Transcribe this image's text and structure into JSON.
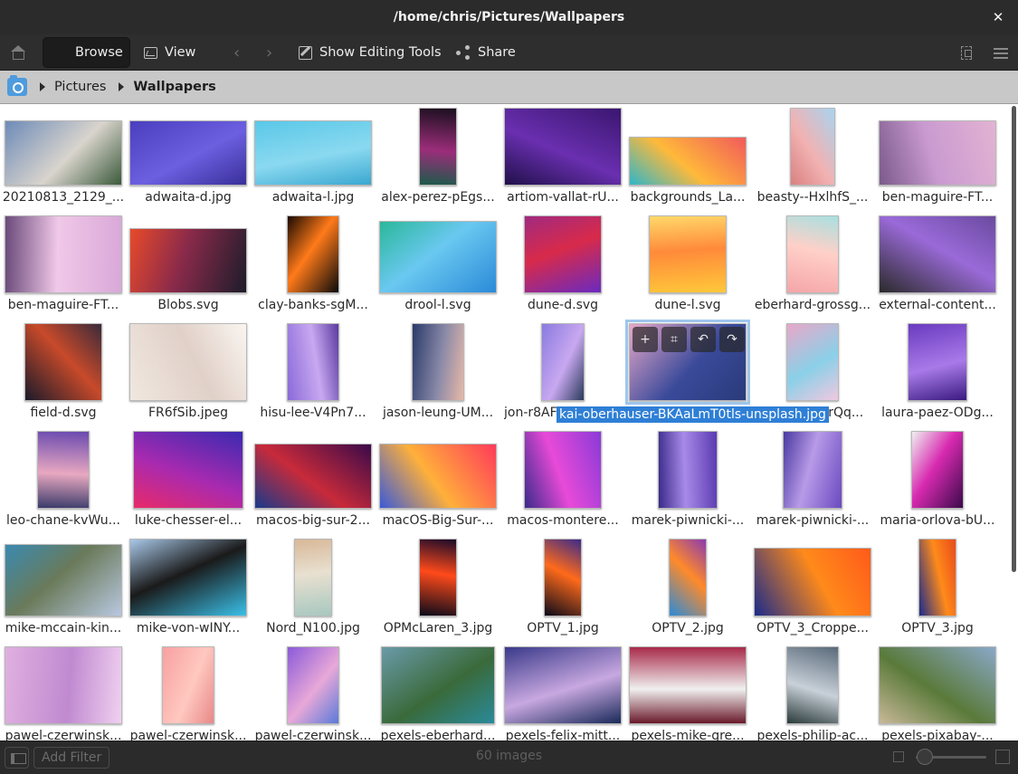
{
  "window": {
    "title": "/home/chris/Pictures/Wallpapers",
    "close_icon": "close-icon"
  },
  "toolbar": {
    "browse_label": "Browse",
    "view_label": "View",
    "editing_label": "Show Editing Tools",
    "share_label": "Share"
  },
  "breadcrumb": {
    "items": [
      "Pictures",
      "Wallpapers"
    ]
  },
  "selected_label": "kai-oberhauser-BKAaLmT0tls-unsplash.jpg",
  "images": [
    {
      "label": "20210813_2129_...",
      "colors": [
        "#6d8bb8",
        "#d9d4cd",
        "#3b5a3a"
      ]
    },
    {
      "label": "adwaita-d.jpg",
      "colors": [
        "#4a3fbf",
        "#6c5fe0",
        "#3a2f9a"
      ]
    },
    {
      "label": "adwaita-l.jpg",
      "colors": [
        "#5ac8e8",
        "#8ad9f0",
        "#3aa7d0"
      ]
    },
    {
      "label": "alex-perez-pEgs...",
      "colors": [
        "#1a0f1e",
        "#9b2d7a",
        "#1b5a4a"
      ]
    },
    {
      "label": "artiom-vallat-rU...",
      "colors": [
        "#3a1670",
        "#6a2fb0",
        "#20104a"
      ]
    },
    {
      "label": "backgrounds_La...",
      "colors": [
        "#f15a5a",
        "#ffb93a",
        "#2fb6c9"
      ]
    },
    {
      "label": "beasty--HxlhfS_...",
      "colors": [
        "#a8d4f0",
        "#f2b2b2",
        "#d98080"
      ]
    },
    {
      "label": "ben-maguire-FT...",
      "colors": [
        "#e3b3d3",
        "#c99ad0",
        "#7b5a8a"
      ]
    },
    {
      "label": "ben-maguire-FT...",
      "colors": [
        "#d9a8d8",
        "#f0c8e8",
        "#6a4a7a"
      ]
    },
    {
      "label": "Blobs.svg",
      "colors": [
        "#1c1c2a",
        "#8a2a4a",
        "#e84a2a"
      ]
    },
    {
      "label": "clay-banks-sgM...",
      "colors": [
        "#0a0a0a",
        "#ff7a1a",
        "#1a0a00"
      ]
    },
    {
      "label": "drool-l.svg",
      "colors": [
        "#2a8ad8",
        "#6ac8f0",
        "#2ab89a"
      ]
    },
    {
      "label": "dune-d.svg",
      "colors": [
        "#6a2ac0",
        "#d82a4a",
        "#a02a80"
      ]
    },
    {
      "label": "dune-l.svg",
      "colors": [
        "#ffc83a",
        "#ff8a3a",
        "#ffd96a"
      ]
    },
    {
      "label": "eberhard-grossg...",
      "colors": [
        "#f5a5a8",
        "#ffd0c8",
        "#a8e0e0"
      ]
    },
    {
      "label": "external-content...",
      "colors": [
        "#2a2a2a",
        "#9a6ad8",
        "#6a4aa0"
      ]
    },
    {
      "label": "field-d.svg",
      "colors": [
        "#1a1a2a",
        "#c84a2a",
        "#3a2a3a"
      ]
    },
    {
      "label": "FR6fSib.jpeg",
      "colors": [
        "#f0e8e0",
        "#e0d0c8",
        "#faf5f0"
      ]
    },
    {
      "label": "hisu-lee-V4Pn7...",
      "colors": [
        "#8a6ad8",
        "#c8a8f0",
        "#5a3aa0"
      ]
    },
    {
      "label": "jason-leung-UM...",
      "colors": [
        "#2a3a6a",
        "#8a8aa8",
        "#e8b8a8"
      ]
    },
    {
      "label": "jon-r8AF",
      "colors": [
        "#8a7ae0",
        "#c8a8f0",
        "#2a3a5a"
      ]
    },
    {
      "label": "kai-oberhauser-BKAaLmT0tls-unsplash.jpg",
      "colors": [
        "#e8a8c8",
        "#3a4a9a",
        "#2a3a7a"
      ]
    },
    {
      "label": "PrQq...",
      "colors": [
        "#e8a8c8",
        "#8ad0e8",
        "#f0c8e0"
      ]
    },
    {
      "label": "laura-paez-ODg...",
      "colors": [
        "#6a3ac0",
        "#a87ae8",
        "#3a1a80"
      ]
    },
    {
      "label": "leo-chane-kvWu...",
      "colors": [
        "#6a4ab0",
        "#e8a8c0",
        "#3a3a6a"
      ]
    },
    {
      "label": "luke-chesser-el...",
      "colors": [
        "#3a2ab0",
        "#a82ab0",
        "#e82a6a"
      ]
    },
    {
      "label": "macos-big-sur-2...",
      "colors": [
        "#3a0a4a",
        "#c82a3a",
        "#1a3a8a"
      ]
    },
    {
      "label": "macOS-Big-Sur-...",
      "colors": [
        "#ff3a5a",
        "#ffb03a",
        "#3a5ad8"
      ]
    },
    {
      "label": "macos-montere...",
      "colors": [
        "#8a3ad8",
        "#e84ad8",
        "#3a2a8a"
      ]
    },
    {
      "label": "marek-piwnicki-...",
      "colors": [
        "#5a3ab0",
        "#a88ae8",
        "#3a2a8a"
      ]
    },
    {
      "label": "marek-piwnicki-...",
      "colors": [
        "#6a4ac0",
        "#b89ae8",
        "#4a3aa0"
      ]
    },
    {
      "label": "maria-orlova-bU...",
      "colors": [
        "#3a0a4a",
        "#d82ab0",
        "#f0f0f0"
      ]
    },
    {
      "label": "mike-mccain-kin...",
      "colors": [
        "#b8c8e0",
        "#6a7a5a",
        "#3a8ab0"
      ]
    },
    {
      "label": "mike-von-wINY...",
      "colors": [
        "#3ac0e8",
        "#1a1a1a",
        "#a8c8e8"
      ]
    },
    {
      "label": "Nord_N100.jpg",
      "colors": [
        "#a8c8c0",
        "#e8e0d0",
        "#d8b898"
      ]
    },
    {
      "label": "OPMcLaren_3.jpg",
      "colors": [
        "#0a0a1a",
        "#ff4a1a",
        "#1a0a2a"
      ]
    },
    {
      "label": "OPTV_1.jpg",
      "colors": [
        "#0a0a1a",
        "#ff6a1a",
        "#3a2a8a"
      ]
    },
    {
      "label": "OPTV_2.jpg",
      "colors": [
        "#2a8ad8",
        "#ff8a2a",
        "#8a3ab0"
      ]
    },
    {
      "label": "OPTV_3_Croppe...",
      "colors": [
        "#1a2a8a",
        "#ff8a1a",
        "#ff5a1a"
      ]
    },
    {
      "label": "OPTV_3.jpg",
      "colors": [
        "#1a2a8a",
        "#ff8a1a",
        "#e84a1a"
      ]
    },
    {
      "label": "pawel-czerwinsk...",
      "colors": [
        "#e0b0e0",
        "#c08ad0",
        "#f0d0f0"
      ]
    },
    {
      "label": "pawel-czerwinsk...",
      "colors": [
        "#f8a0a0",
        "#ffc8c0",
        "#e88888"
      ]
    },
    {
      "label": "pawel-czerwinsk...",
      "colors": [
        "#8a5ad8",
        "#e8a8d8",
        "#5a7ad8"
      ]
    },
    {
      "label": "pexels-eberhard...",
      "colors": [
        "#6a9aa8",
        "#3a6a3a",
        "#2a8a9a"
      ]
    },
    {
      "label": "pexels-felix-mitt...",
      "colors": [
        "#3a3a8a",
        "#c8a8e0",
        "#1a2a5a"
      ]
    },
    {
      "label": "pexels-mike-gre...",
      "colors": [
        "#a82a4a",
        "#f0f0f0",
        "#6a1a2a"
      ]
    },
    {
      "label": "pexels-philip-ac...",
      "colors": [
        "#5a6a7a",
        "#c8d0d8",
        "#2a3a3a"
      ]
    },
    {
      "label": "pexels-pixabay-...",
      "colors": [
        "#8aa8c8",
        "#5a7a3a",
        "#c8b898"
      ]
    }
  ],
  "status": {
    "filter_label": "Add Filter",
    "count_label": "60 images"
  }
}
